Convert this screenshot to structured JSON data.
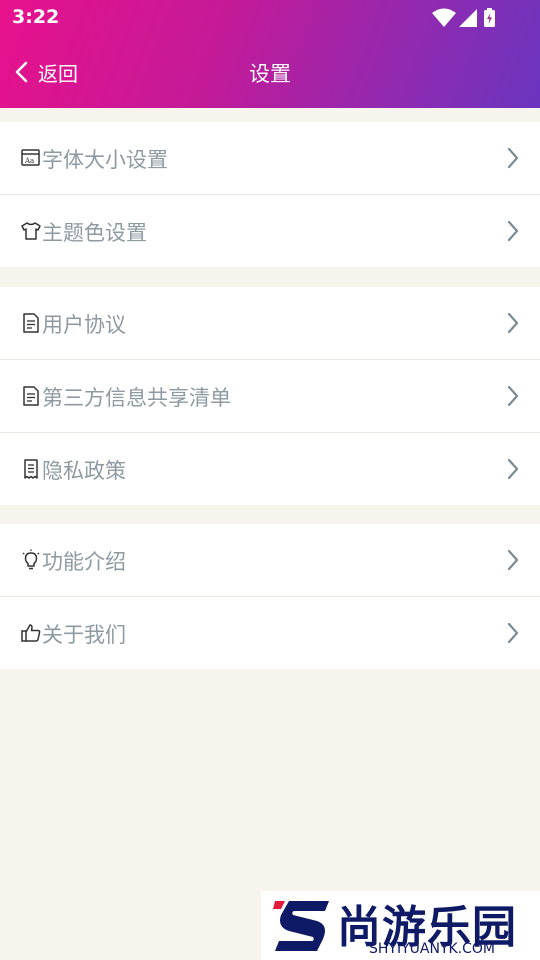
{
  "status_bar": {
    "time": "3:22"
  },
  "nav": {
    "back_label": "返回",
    "title": "设置"
  },
  "groups": [
    {
      "items": [
        {
          "label": "字体大小设置",
          "icon": "font-size-icon"
        },
        {
          "label": "主题色设置",
          "icon": "tshirt-icon"
        }
      ]
    },
    {
      "items": [
        {
          "label": "用户协议",
          "icon": "document-icon"
        },
        {
          "label": "第三方信息共享清单",
          "icon": "document-icon"
        },
        {
          "label": "隐私政策",
          "icon": "receipt-icon"
        }
      ]
    },
    {
      "items": [
        {
          "label": "功能介绍",
          "icon": "lightbulb-icon"
        },
        {
          "label": "关于我们",
          "icon": "thumbs-up-icon"
        }
      ]
    }
  ],
  "watermark": {
    "name": "尚游乐园",
    "site": "SHYIYUANYK.COM"
  },
  "colors": {
    "header_start": "#e8118c",
    "header_end": "#6a35bf",
    "label": "#8e9aa2",
    "page_bg": "#f7f4ee"
  }
}
